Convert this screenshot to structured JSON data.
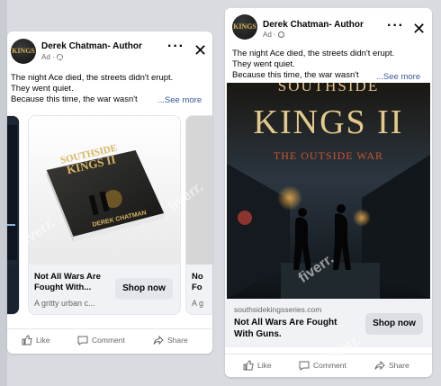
{
  "colors": {
    "accent_link": "#385898",
    "secondary_text": "#65676b",
    "button_bg": "#e4e6eb"
  },
  "ad1": {
    "author": "Derek Chatman- Author",
    "sponsored": "Ad ·",
    "avatar_text": "KINGS",
    "more_icon": "more-horizontal-icon",
    "close_icon": "close-icon",
    "body_lines": [
      "The night Ace died, the streets didn't erupt.",
      "They went quiet.",
      "Because this time, the war wasn't"
    ],
    "see_more": "...See more",
    "carousel": {
      "left_card_fragment": "",
      "main_card": {
        "book_title_line1": "SOUTHSIDE",
        "book_title_line2": "KINGS II",
        "book_author": "DEREK CHATMAN",
        "title_line1": "Not All Wars Are",
        "title_line2": "Fought With...",
        "desc": "A gritty urban c...",
        "cta": "Shop now"
      },
      "right_card": {
        "title_line1": "No",
        "title_line2": "Fo",
        "desc": "A g"
      }
    },
    "actions": {
      "like": "Like",
      "comment": "Comment",
      "share": "Share"
    }
  },
  "ad2": {
    "author": "Derek Chatman- Author",
    "sponsored": "Ad ·",
    "avatar_text": "KINGS",
    "body_lines": [
      "The night Ace died, the streets didn't erupt.",
      "They went quiet.",
      "Because this time, the war wasn't"
    ],
    "see_more": "...See more",
    "cover": {
      "title_line1": "SOUTHSIDE",
      "title_line2": "KINGS II",
      "subtitle": "THE OUTSIDE WAR"
    },
    "link": {
      "url": "southsidekingsseries.com",
      "title_line1": "Not All Wars Are Fought",
      "title_line2": "With Guns.",
      "cta": "Shop now"
    },
    "actions": {
      "like": "Like",
      "comment": "Comment",
      "share": "Share"
    }
  },
  "watermark_text": "fiverr."
}
